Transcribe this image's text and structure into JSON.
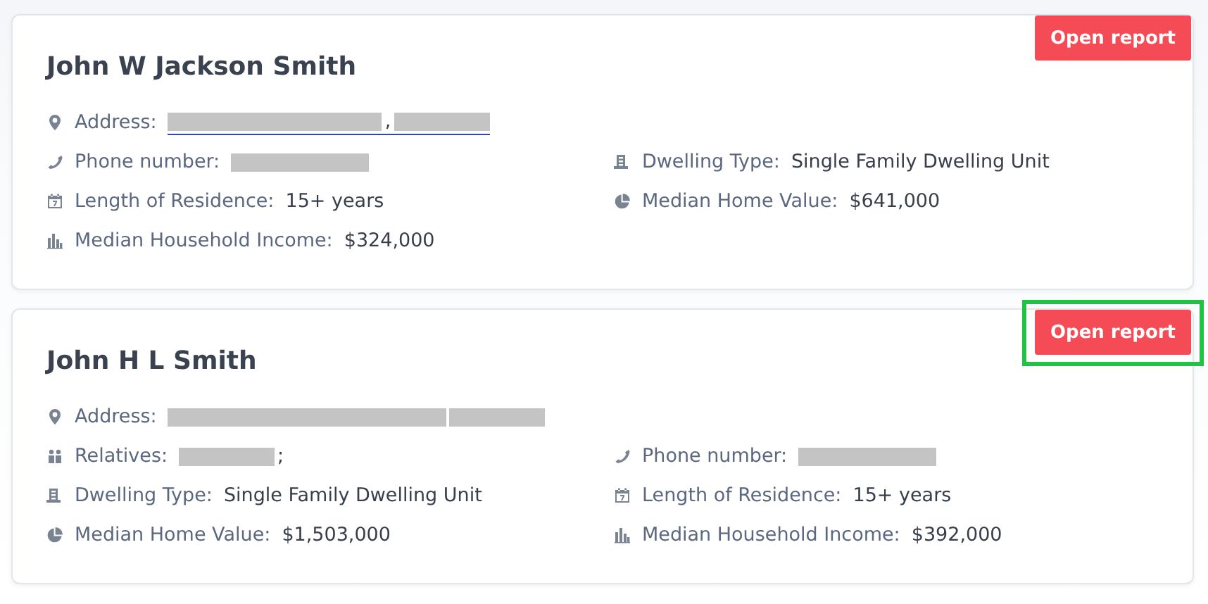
{
  "cards": [
    {
      "name": "John W Jackson Smith",
      "button": {
        "label": "Open report",
        "highlighted": false
      },
      "address": {
        "kind": "pin",
        "label": "Address:",
        "link": true,
        "parts": [
          {
            "kind": "redacted-long"
          },
          {
            "kind": "text",
            "text": ","
          },
          {
            "kind": "redacted-short"
          }
        ]
      },
      "fields": [
        {
          "kind": "phone",
          "label": "Phone number:",
          "parts": [
            {
              "kind": "redacted-medium"
            }
          ]
        },
        {
          "kind": "building",
          "label": "Dwelling Type:",
          "parts": [
            {
              "kind": "text",
              "text": "Single Family Dwelling Unit"
            }
          ]
        },
        {
          "kind": "calendar",
          "label": "Length of Residence:",
          "parts": [
            {
              "kind": "text",
              "text": "15+ years"
            }
          ]
        },
        {
          "kind": "pie",
          "label": "Median Home Value:",
          "parts": [
            {
              "kind": "text",
              "text": "$641,000"
            }
          ]
        },
        {
          "kind": "bars",
          "label": "Median Household Income:",
          "parts": [
            {
              "kind": "text",
              "text": "$324,000"
            }
          ]
        }
      ]
    },
    {
      "name": "John H L Smith",
      "button": {
        "label": "Open report",
        "highlighted": true
      },
      "address": {
        "kind": "pin",
        "label": "Address:",
        "link": false,
        "parts": [
          {
            "kind": "redacted-xlong"
          },
          {
            "kind": "redacted-short"
          }
        ]
      },
      "fields": [
        {
          "kind": "people",
          "label": "Relatives:",
          "parts": [
            {
              "kind": "redacted-short"
            },
            {
              "kind": "text",
              "text": ";"
            }
          ]
        },
        {
          "kind": "phone",
          "label": "Phone number:",
          "parts": [
            {
              "kind": "redacted-medium"
            }
          ]
        },
        {
          "kind": "building",
          "label": "Dwelling Type:",
          "parts": [
            {
              "kind": "text",
              "text": "Single Family Dwelling Unit"
            }
          ]
        },
        {
          "kind": "calendar",
          "label": "Length of Residence:",
          "parts": [
            {
              "kind": "text",
              "text": "15+ years"
            }
          ]
        },
        {
          "kind": "pie",
          "label": "Median Home Value:",
          "parts": [
            {
              "kind": "text",
              "text": "$1,503,000"
            }
          ]
        },
        {
          "kind": "bars",
          "label": "Median Household Income:",
          "parts": [
            {
              "kind": "text",
              "text": "$392,000"
            }
          ]
        }
      ]
    }
  ]
}
